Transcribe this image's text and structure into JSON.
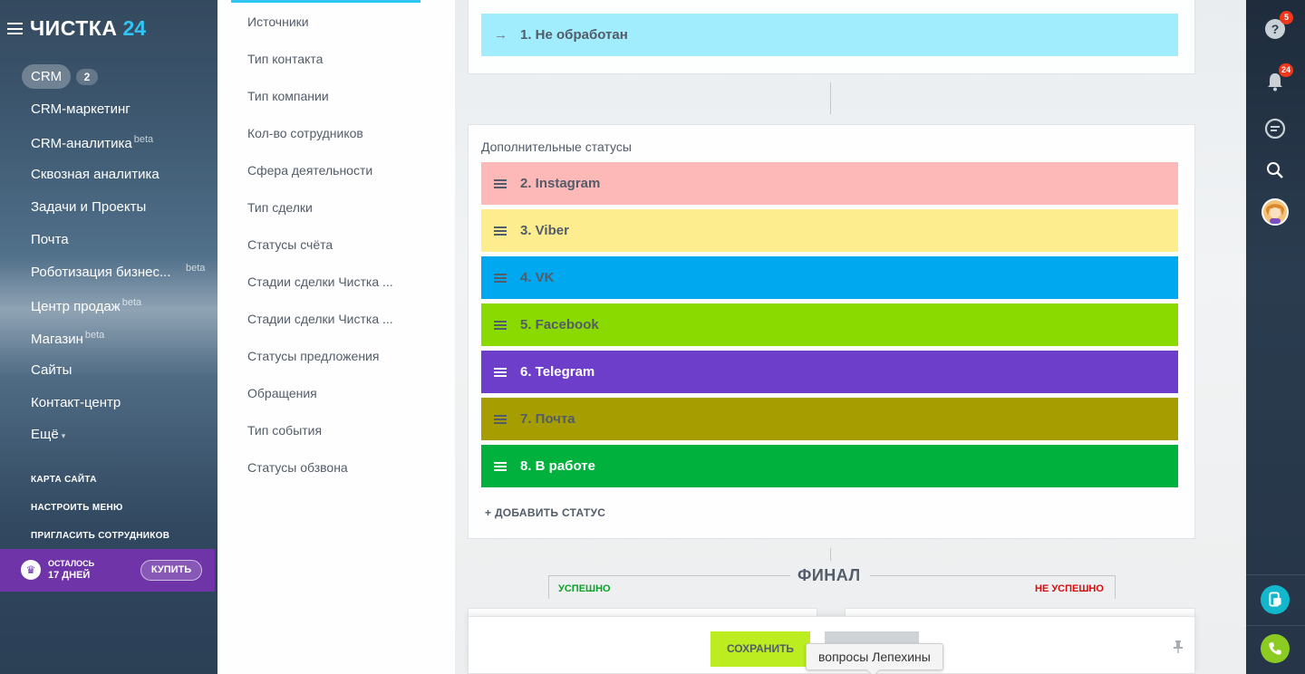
{
  "sidebar": {
    "logo_text": "ЧИСТКА",
    "logo_num": "24",
    "crm_label": "CRM",
    "crm_count": "2",
    "items": [
      {
        "label": "CRM-маркетинг",
        "beta": ""
      },
      {
        "label": "CRM-аналитика",
        "beta": "beta"
      },
      {
        "label": "Сквозная аналитика",
        "beta": ""
      },
      {
        "label": "Задачи и Проекты",
        "beta": ""
      },
      {
        "label": "Почта",
        "beta": ""
      },
      {
        "label": "Роботизация бизнес...",
        "beta": "beta"
      },
      {
        "label": "Центр продаж",
        "beta": "beta"
      },
      {
        "label": "Магазин",
        "beta": "beta"
      },
      {
        "label": "Сайты",
        "beta": ""
      },
      {
        "label": "Контакт-центр",
        "beta": ""
      },
      {
        "label": "Ещё",
        "beta": ""
      }
    ],
    "links": [
      "КАРТА САЙТА",
      "НАСТРОИТЬ МЕНЮ",
      "ПРИГЛАСИТЬ СОТРУДНИКОВ"
    ],
    "trial_line1": "ОСТАЛОСЬ",
    "trial_line2": "17 ДНЕЙ",
    "buy_label": "КУПИТЬ"
  },
  "nav": {
    "items": [
      "Источники",
      "Тип контакта",
      "Тип компании",
      "Кол-во сотрудников",
      "Сфера деятельности",
      "Тип сделки",
      "Статусы счёта",
      "Стадии сделки Чистка ...",
      "Стадии сделки Чистка ...",
      "Статусы предложения",
      "Обращения",
      "Тип события",
      "Статусы обзвона"
    ]
  },
  "main": {
    "initial_status": {
      "label": "1. Не обработан",
      "color": "#a1ecfd",
      "text_color": "#535c69"
    },
    "extra_title": "Дополнительные статусы",
    "statuses": [
      {
        "label": "2. Instagram",
        "color": "#fdb8b8",
        "text_color": "#535c69"
      },
      {
        "label": "3. Viber",
        "color": "#fded8f",
        "text_color": "#535c69"
      },
      {
        "label": "4. VK",
        "color": "#00a8f0",
        "text_color": "#535c69"
      },
      {
        "label": "5. Facebook",
        "color": "#8ada00",
        "text_color": "#535c69"
      },
      {
        "label": "6. Telegram",
        "color": "#6c3ec9",
        "text_color": "#ffffff"
      },
      {
        "label": "7. Почта",
        "color": "#a69e00",
        "text_color": "#535c69"
      },
      {
        "label": "8. В работе",
        "color": "#00b13d",
        "text_color": "#ffffff"
      }
    ],
    "add_status_label": "+ ДОБАВИТЬ СТАТУС",
    "final_title": "ФИНАЛ",
    "success_label": "УСПЕШНО",
    "fail_label": "НЕ УСПЕШНО",
    "save_label": "СОХРАНИТЬ",
    "tooltip": "вопросы Лепехины"
  },
  "rightbar": {
    "help_badge": "5",
    "notify_badge": "24"
  },
  "colors": {
    "accent": "#2fc6f6",
    "save": "#bbed21",
    "success": "#0ca22a",
    "fail": "#d20e0e",
    "trial": "#6e34a8"
  }
}
